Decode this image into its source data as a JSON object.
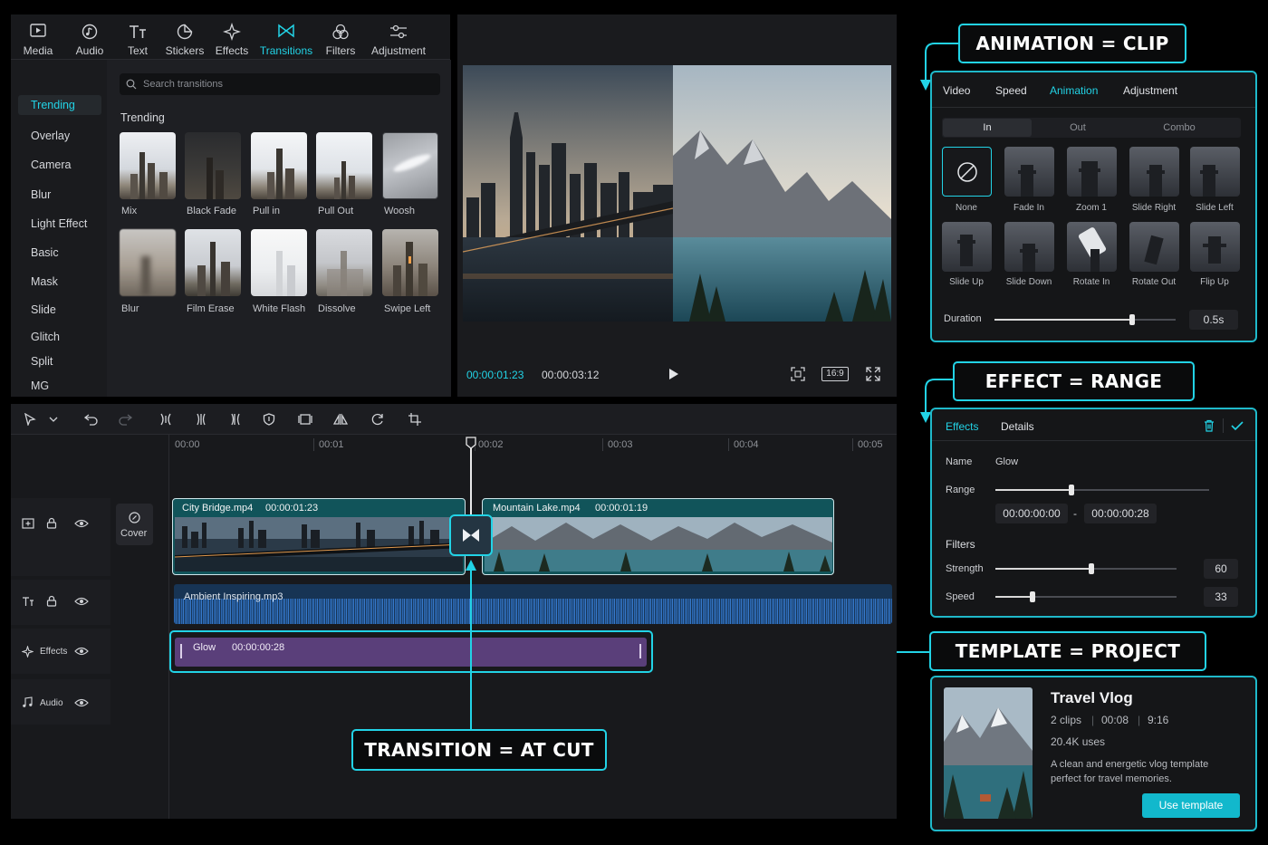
{
  "toolbar": {
    "items": [
      {
        "label": "Media",
        "icon": "media-icon"
      },
      {
        "label": "Audio",
        "icon": "audio-icon"
      },
      {
        "label": "Text",
        "icon": "text-icon"
      },
      {
        "label": "Stickers",
        "icon": "stickers-icon"
      },
      {
        "label": "Effects",
        "icon": "effects-icon"
      },
      {
        "label": "Transitions",
        "icon": "transitions-icon",
        "active": true
      },
      {
        "label": "Filters",
        "icon": "filters-icon"
      },
      {
        "label": "Adjustment",
        "icon": "adjustment-icon"
      }
    ]
  },
  "sidebar": {
    "items": [
      "Trending",
      "Overlay",
      "Camera",
      "Blur",
      "Light Effect",
      "Basic",
      "Mask",
      "Slide",
      "Glitch",
      "Split",
      "MG"
    ]
  },
  "transitions": {
    "search_placeholder": "Search transitions",
    "section": "Trending",
    "items": [
      "Mix",
      "Black Fade",
      "Pull in",
      "Pull Out",
      "Woosh",
      "Blur",
      "Film Erase",
      "White Flash",
      "Dissolve",
      "Swipe Left"
    ]
  },
  "preview": {
    "current_time": "00:00:01:23",
    "total_time": "00:00:03:12",
    "aspect": "16:9"
  },
  "animation_panel": {
    "callout": "ANIMATION = CLIP",
    "tabs": [
      "Video",
      "Speed",
      "Animation",
      "Adjustment"
    ],
    "active_tab": "Animation",
    "subtabs": [
      "In",
      "Out",
      "Combo"
    ],
    "presets": [
      "None",
      "Fade In",
      "Zoom 1",
      "Slide Right",
      "Slide Left",
      "Slide Up",
      "Slide Down",
      "Rotate In",
      "Rotate Out",
      "Flip Up"
    ],
    "duration_label": "Duration",
    "duration_value": "0.5s",
    "duration_fraction": 0.8
  },
  "effect_panel": {
    "callout": "EFFECT = RANGE",
    "tabs": [
      "Effects",
      "Details"
    ],
    "name_label": "Name",
    "name_value": "Glow",
    "range_label": "Range",
    "range_start": "00:00:00:00",
    "range_sep": "-",
    "range_end": "00:00:00:28",
    "filters_label": "Filters",
    "strength_label": "Strength",
    "strength_value": "60",
    "speed_label": "Speed",
    "speed_value": "33"
  },
  "template_panel": {
    "callout": "TEMPLATE = PROJECT",
    "title": "Travel Vlog",
    "clips": "2 clips",
    "duration": "00:08",
    "ratio": "9:16",
    "uses": "20.4K uses",
    "desc1": "A clean and energetic vlog template",
    "desc2": "perfect for travel memories.",
    "button": "Use template"
  },
  "timeline": {
    "ticks": [
      "00:00",
      "00:01",
      "00:02",
      "00:03",
      "00:04",
      "00:05"
    ],
    "cover": "Cover",
    "clip1_name": "City Bridge.mp4",
    "clip1_dur": "00:00:01:23",
    "clip2_name": "Mountain Lake.mp4",
    "clip2_dur": "00:00:01:19",
    "audio_name": "Ambient Inspiring.mp3",
    "effect_name": "Glow",
    "effect_dur": "00:00:00:28",
    "track_effects": "Effects",
    "track_audio": "Audio",
    "transition_callout": "TRANSITION = AT CUT"
  },
  "colors": {
    "accent": "#22d3e6",
    "effect_bar": "#5a3f7a",
    "audio": "#1d4f86"
  }
}
